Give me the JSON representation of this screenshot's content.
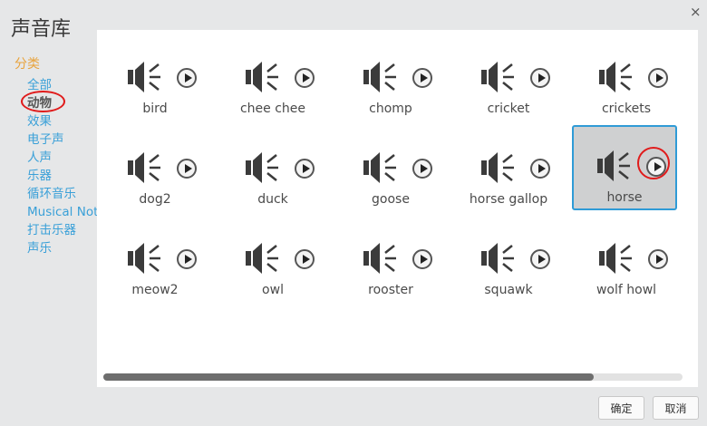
{
  "dialog": {
    "title": "声音库",
    "close_symbol": "×"
  },
  "sidebar": {
    "heading": "分类",
    "items": [
      {
        "label": "全部",
        "selected": false
      },
      {
        "label": "动物",
        "selected": true
      },
      {
        "label": "效果",
        "selected": false
      },
      {
        "label": "电子声",
        "selected": false
      },
      {
        "label": "人声",
        "selected": false
      },
      {
        "label": "乐器",
        "selected": false
      },
      {
        "label": "循环音乐",
        "selected": false
      },
      {
        "label": "Musical Notes",
        "selected": false
      },
      {
        "label": "打击乐器",
        "selected": false
      },
      {
        "label": "声乐",
        "selected": false
      }
    ]
  },
  "sounds": [
    {
      "name": "bird",
      "selected": false
    },
    {
      "name": "chee chee",
      "selected": false
    },
    {
      "name": "chomp",
      "selected": false
    },
    {
      "name": "cricket",
      "selected": false
    },
    {
      "name": "crickets",
      "selected": false
    },
    {
      "name": "dog2",
      "selected": false
    },
    {
      "name": "duck",
      "selected": false
    },
    {
      "name": "goose",
      "selected": false
    },
    {
      "name": "horse gallop",
      "selected": false
    },
    {
      "name": "horse",
      "selected": true
    },
    {
      "name": "meow2",
      "selected": false
    },
    {
      "name": "owl",
      "selected": false
    },
    {
      "name": "rooster",
      "selected": false
    },
    {
      "name": "squawk",
      "selected": false
    },
    {
      "name": "wolf howl",
      "selected": false
    }
  ],
  "footer": {
    "ok_label": "确定",
    "cancel_label": "取消"
  },
  "colors": {
    "accent": "#2f9bd6",
    "category": "#3aa0d8",
    "heading": "#e8a33d",
    "highlight": "#e01b1b"
  }
}
